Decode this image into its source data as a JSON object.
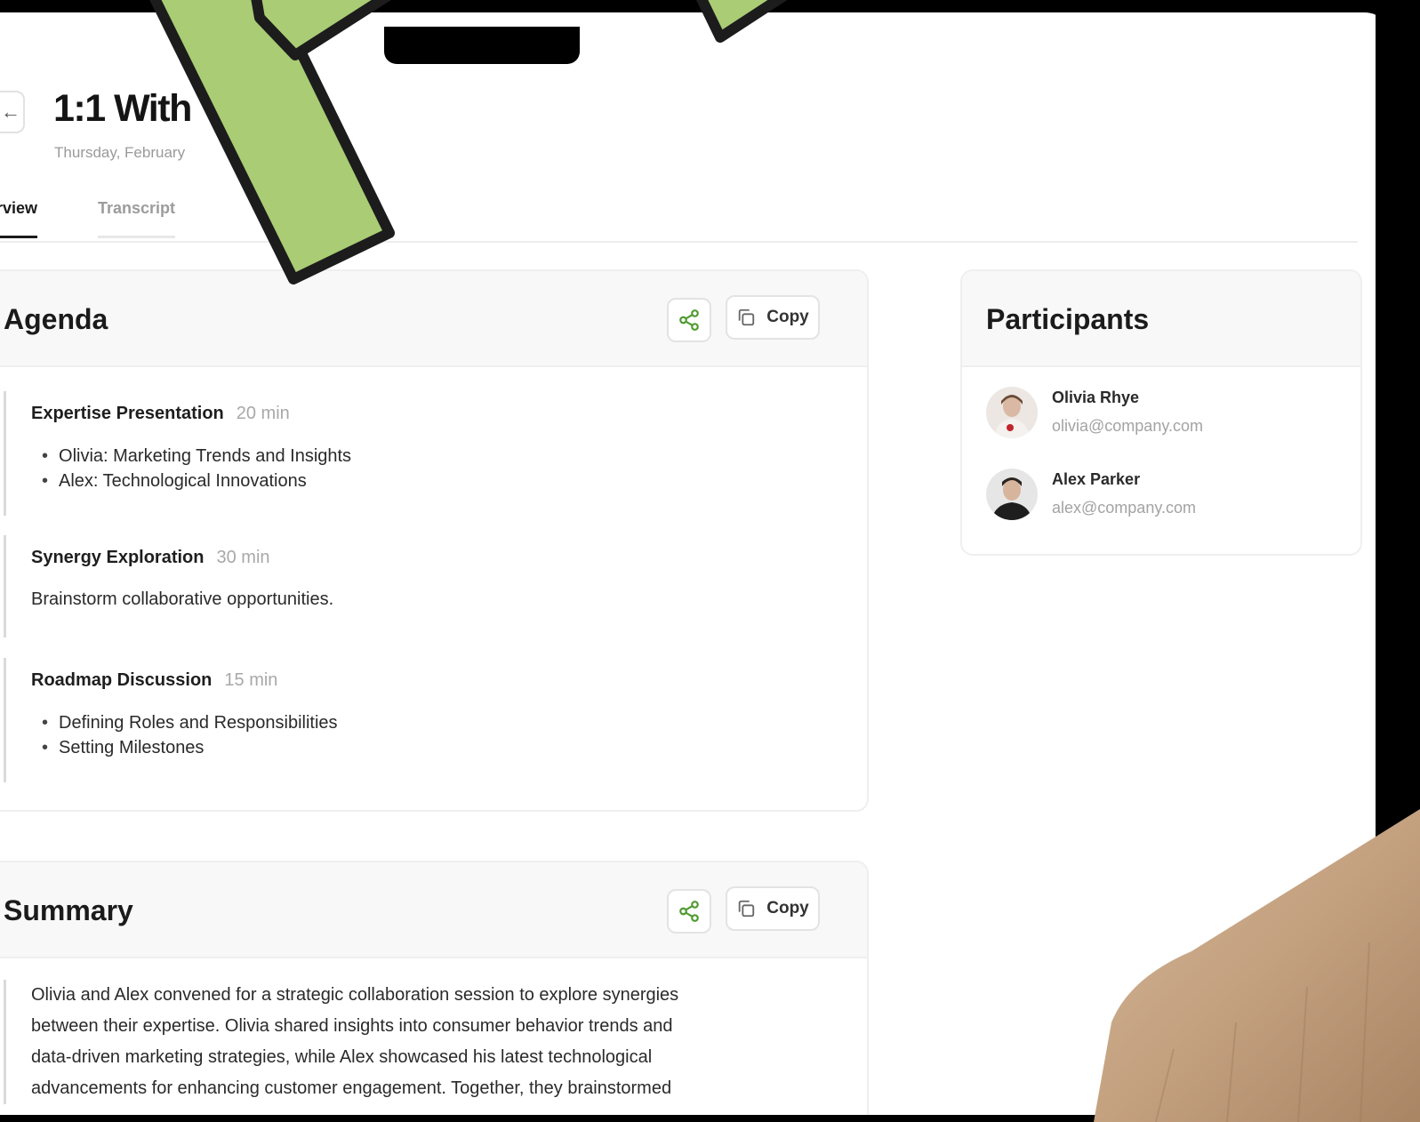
{
  "page": {
    "back_icon": "arrow-left-icon",
    "title": "1:1 With",
    "date": "Thursday, February"
  },
  "tabs": [
    {
      "label": "erview",
      "active": true
    },
    {
      "label": "Transcript",
      "active": false
    }
  ],
  "agenda": {
    "title": "Agenda",
    "share_icon": "share-icon",
    "copy_label": "Copy",
    "copy_icon": "copy-icon",
    "sections": [
      {
        "title": "Expertise Presentation",
        "duration": "20 min",
        "bullets": [
          "Olivia: Marketing Trends and Insights",
          "Alex: Technological Innovations"
        ]
      },
      {
        "title": "Synergy Exploration",
        "duration": "30 min",
        "text": "Brainstorm collaborative opportunities."
      },
      {
        "title": "Roadmap Discussion",
        "duration": "15 min",
        "bullets": [
          "Defining Roles and Responsibilities",
          "Setting Milestones"
        ]
      }
    ]
  },
  "summary": {
    "title": "Summary",
    "copy_label": "Copy",
    "lines": [
      "Olivia and Alex convened for a strategic collaboration session to explore synergies",
      "between their expertise. Olivia shared insights into consumer behavior trends and",
      "data-driven marketing strategies, while Alex showcased his latest technological",
      "advancements for enhancing customer engagement. Together, they brainstormed"
    ]
  },
  "participants": {
    "title": "Participants",
    "people": [
      {
        "name": "Olivia Rhye",
        "email": "olivia@company.com"
      },
      {
        "name": "Alex Parker",
        "email": "alex@company.com"
      }
    ]
  },
  "colors": {
    "accent_green": "#4e9a2e",
    "highlight_green": "#a9cc74",
    "frame": "#000000"
  }
}
